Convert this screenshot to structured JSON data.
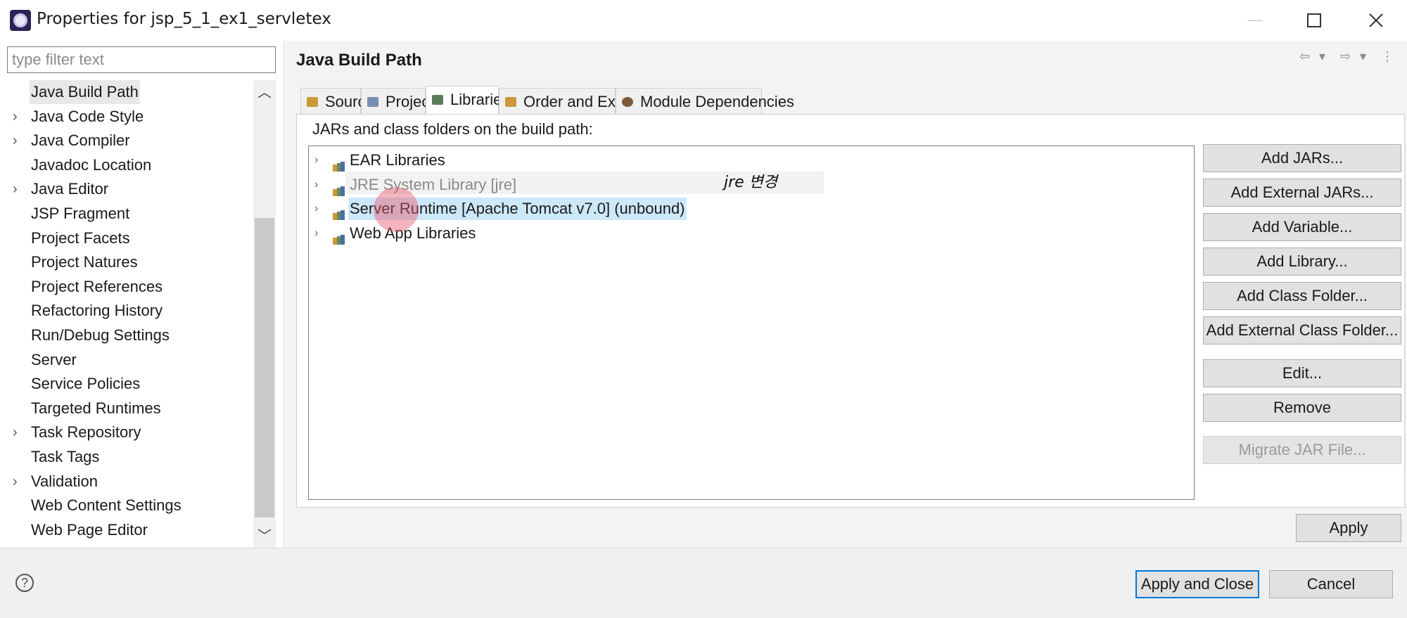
{
  "window": {
    "title": "Properties for jsp_5_1_ex1_servletex",
    "minimize_glyph": "—",
    "maximize_glyph": "☐",
    "close_glyph": "✕"
  },
  "left_nav": {
    "filter_placeholder": "type filter text",
    "items": [
      {
        "label": "Java Build Path",
        "expandable": false,
        "selected": true
      },
      {
        "label": "Java Code Style",
        "expandable": true
      },
      {
        "label": "Java Compiler",
        "expandable": true
      },
      {
        "label": "Javadoc Location",
        "expandable": false
      },
      {
        "label": "Java Editor",
        "expandable": true
      },
      {
        "label": "JSP Fragment",
        "expandable": false
      },
      {
        "label": "Project Facets",
        "expandable": false
      },
      {
        "label": "Project Natures",
        "expandable": false
      },
      {
        "label": "Project References",
        "expandable": false
      },
      {
        "label": "Refactoring History",
        "expandable": false
      },
      {
        "label": "Run/Debug Settings",
        "expandable": false
      },
      {
        "label": "Server",
        "expandable": false
      },
      {
        "label": "Service Policies",
        "expandable": false
      },
      {
        "label": "Targeted Runtimes",
        "expandable": false
      },
      {
        "label": "Task Repository",
        "expandable": true
      },
      {
        "label": "Task Tags",
        "expandable": false
      },
      {
        "label": "Validation",
        "expandable": true
      },
      {
        "label": "Web Content Settings",
        "expandable": false
      },
      {
        "label": "Web Page Editor",
        "expandable": false
      }
    ]
  },
  "main": {
    "title": "Java Build Path",
    "tabs": [
      {
        "label": "Source",
        "icon": "source-folder-icon"
      },
      {
        "label": "Projects",
        "icon": "projects-icon"
      },
      {
        "label": "Libraries",
        "icon": "libraries-icon",
        "active": true
      },
      {
        "label": "Order and Export",
        "icon": "order-export-icon"
      },
      {
        "label": "Module Dependencies",
        "icon": "module-dependencies-icon"
      }
    ],
    "section_label": "JARs and class folders on the build path:",
    "libraries": [
      {
        "label": "EAR Libraries"
      },
      {
        "label": "JRE System Library [jre]",
        "disabled": true
      },
      {
        "label": "Server Runtime [Apache Tomcat v7.0] (unbound)",
        "highlight": true
      },
      {
        "label": "Web App Libraries"
      }
    ],
    "annotation": "jre 변경",
    "buttons": {
      "add_jars": "Add JARs...",
      "add_external_jars": "Add External JARs...",
      "add_variable": "Add Variable...",
      "add_library": "Add Library...",
      "add_class_folder": "Add Class Folder...",
      "add_external_class_folder": "Add External Class Folder...",
      "edit": "Edit...",
      "remove": "Remove",
      "migrate_jar": "Migrate JAR File..."
    },
    "apply": "Apply"
  },
  "footer": {
    "help_glyph": "?",
    "apply_and_close": "Apply and Close",
    "cancel": "Cancel"
  }
}
